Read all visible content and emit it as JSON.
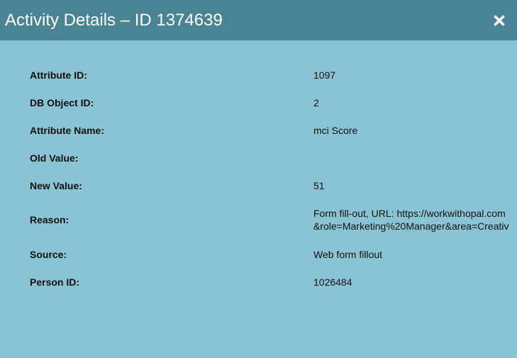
{
  "dialog": {
    "title": "Activity Details – ID 1374639",
    "close_icon": "close-x-icon"
  },
  "fields": [
    {
      "label": "Attribute ID:",
      "value": "1097"
    },
    {
      "label": "DB Object ID:",
      "value": "2"
    },
    {
      "label": "Attribute Name:",
      "value": "mci Score"
    },
    {
      "label": "Old Value:",
      "value": ""
    },
    {
      "label": "New Value:",
      "value": "51"
    },
    {
      "label": "Reason:",
      "value_lines": [
        "Form fill-out, URL: https://workwithopal.com",
        "&role=Marketing%20Manager&area=Creativ"
      ]
    },
    {
      "label": "Source:",
      "value": "Web form fillout"
    },
    {
      "label": "Person ID:",
      "value": "1026484"
    }
  ],
  "colors": {
    "header_bg": "#4a8394",
    "body_bg": "#8ac4d4",
    "title_text": "#ffffff",
    "text": "#111111"
  }
}
